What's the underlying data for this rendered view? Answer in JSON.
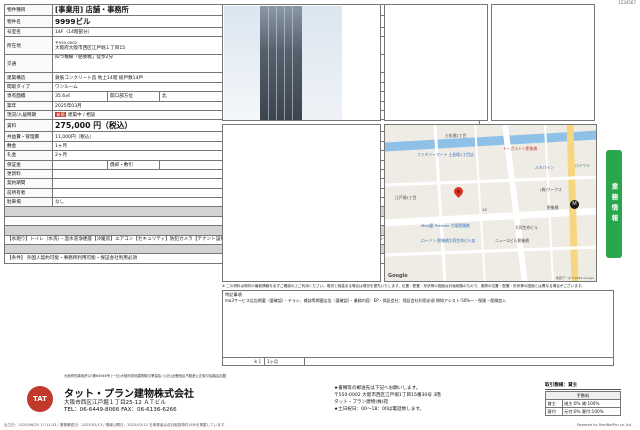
{
  "top_note": "1234567",
  "spec": {
    "kind_label": "物件種目",
    "kind_value": "[事業用] 店舗・事務所",
    "name_label": "物件名",
    "name_value": "9999ビル",
    "room_label": "号室名",
    "room_value": "14F（14階部分）",
    "addr_label": "所在地",
    "addr_zip": "〒550-0002",
    "addr_value": "大阪府大阪市西区江戸堀１丁目15",
    "traffic_label": "交通",
    "traffic_value": "四つ橋線「肥後橋」徒歩2分",
    "structure_label": "建築構造",
    "structure_value": "鉄筋コンクリート造 地上14階 総戸数14戸",
    "layout_label": "間取タイプ",
    "layout_value": "ワンルーム",
    "area_label": "専有面積",
    "area_value": "35.6㎡",
    "direction_label": "開口部方位",
    "direction_value": "北",
    "built_label": "築年",
    "built_value": "2025年03月",
    "status_label": "現況/入居時期",
    "status_badge": "新築",
    "status_value": "建築中 / 相談",
    "rent_label": "賃料",
    "rent_value": "275,000 円（税込）",
    "common_label": "共益費・管理費",
    "common_value": "11,000円（税込）",
    "deposit_label": "敷金",
    "deposit_value": "1ヶ月",
    "key_label": "礼金",
    "key_value": "2ヶ月",
    "hosho_label": "保証金",
    "hosho_value": "",
    "shokyaku_label": "償却・敷引",
    "shokyaku_value": "",
    "renewal_label": "更新料",
    "renewal_value": "",
    "contract_label": "契約期間",
    "contract_value": "",
    "rights_label": "前所有者",
    "rights_value": "",
    "parking_label": "駐車場",
    "parking_value": "なし",
    "bar_biko": "備 考",
    "bar_setsubi": "設 備",
    "setsubi_text": "【水廻り】トイレ（水洗）・温水洗浄便座【冷暖房】エアコン【セキュリティ】防犯カメラ【テナント設備】24時間利用可・スケルトン・ワンフロア【その他】家具ごみ置場・エレベーター（1基）・電気・ガス（都市ガス）・水道",
    "bar_joken": "条 件",
    "joken_text": "【条件】 外国人契約可能・事務所利用可能・保証会社利用必須"
  },
  "map": {
    "labels": [
      "ファミリーマート 土佐堀1丁目店",
      "トーガストン肥後橋",
      "(株)ワークス",
      "肥後橋",
      "ロイヤル",
      "ローソン 肥後橋大同生命ビル店",
      "Meiji屋 Premier 大阪肥後橋",
      "ニュースビル肥後橋",
      "大同生命ビル",
      "土佐堀1丁目",
      "江戸堀1丁目",
      "ルネパイン",
      "15"
    ],
    "station_symbol": "Ｍ",
    "google": "Google",
    "copyright": "地図データ ©2024 Google"
  },
  "side_tab": "業務情報",
  "notice": "※ 二の資料は物件の最新情報を必ずご確認の上ご利用ください。現況と相違ある場合は現況を優先いたします。位置・配置・形状等の図面は計画段階のもので、実際の位置・配置・形状等の図面とは異なる場合がございます。",
  "remarks": {
    "label": "特記事項",
    "text": "mo3サービス広告掲載（要確認）・チラシ、雑誌等掲載広告（要確認）・業務内容：EP・保証会社：保証会社利用必須 問知アシスト-50%～・保険・保険加入",
    "foot_k": "ｋ１",
    "foot_v": "1ヶ月"
  },
  "footer": {
    "license_1": "大阪府知事免許(2)第64946号 (一社)大阪府宅地建物取引業協会 (公社)近畿地区不動産公正取引協議会加盟",
    "license_2": "公正取引協議会加盟",
    "logo": "TAT",
    "company": "タット・プラン建物株式会社",
    "address": "大阪市西区江戸堀１丁目25-12 ＡＴビル",
    "tel": "TEL：06-6449-8066 FAX：06-6136-6266",
    "bullet_1": "★書類等の郵送先は下記へお願いします。",
    "bullet_2": "〒550-0002 大阪市西区江戸堀1丁目15番30号 3階",
    "bullet_3": "タット・プラン建物(株)宛",
    "bullet_4": "★土日祝日：00～18：00は電話致します。",
    "deal_title": "取引態様：貸主",
    "fee_head": "手数料",
    "fee_rows": [
      {
        "k": "貸主",
        "v": "借主:0% 貸:100%"
      },
      {
        "k": "客付",
        "v": "元付:0% 客付:100%"
      }
    ],
    "print_left": "出力日：2025/06/20 17:11:33 / 業務確認日：2025/02/13 / 情報公開日：2025/02/12 当事業者は自社取扱物件のみを掲載しています",
    "print_right": "Powered by RealNetPro co.,ltd."
  }
}
